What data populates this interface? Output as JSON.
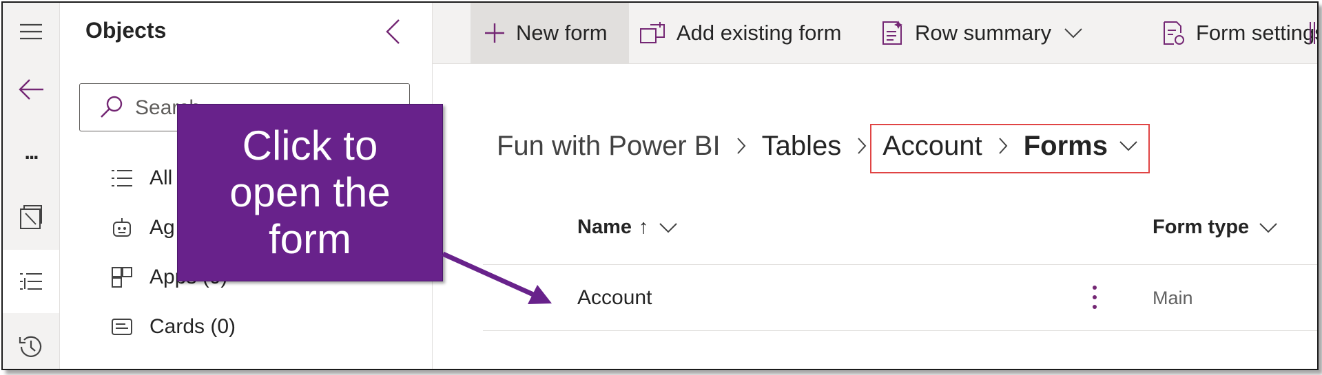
{
  "colors": {
    "accent": "#742774",
    "callout_bg": "#68228b",
    "highlight_border": "#e04444",
    "rail_bg": "#f3f2f1"
  },
  "rail": {
    "icons": [
      "hamburger-icon",
      "back-arrow-icon",
      "more-icon",
      "layers-icon",
      "list-icon",
      "history-icon"
    ],
    "more_label": "..."
  },
  "objects": {
    "title": "Objects",
    "search": {
      "placeholder": "Search"
    },
    "items": [
      {
        "label": "All",
        "icon": "list-icon"
      },
      {
        "label": "Ag",
        "icon": "agent-icon"
      },
      {
        "label": "Apps  (0)",
        "icon": "apps-icon"
      },
      {
        "label": "Cards  (0)",
        "icon": "card-icon"
      }
    ]
  },
  "commands": {
    "new_form": "New form",
    "add_existing": "Add existing form",
    "row_summary": "Row summary",
    "form_settings": "Form settings"
  },
  "breadcrumb": {
    "solution": "Fun with Power BI",
    "tables": "Tables",
    "table": "Account",
    "current": "Forms"
  },
  "table": {
    "columns": {
      "name": "Name",
      "sort_indicator": "↑",
      "form_type": "Form type"
    },
    "rows": [
      {
        "name": "Account",
        "form_type": "Main"
      }
    ]
  },
  "callout": {
    "text": "Click to\nopen the\nform"
  }
}
